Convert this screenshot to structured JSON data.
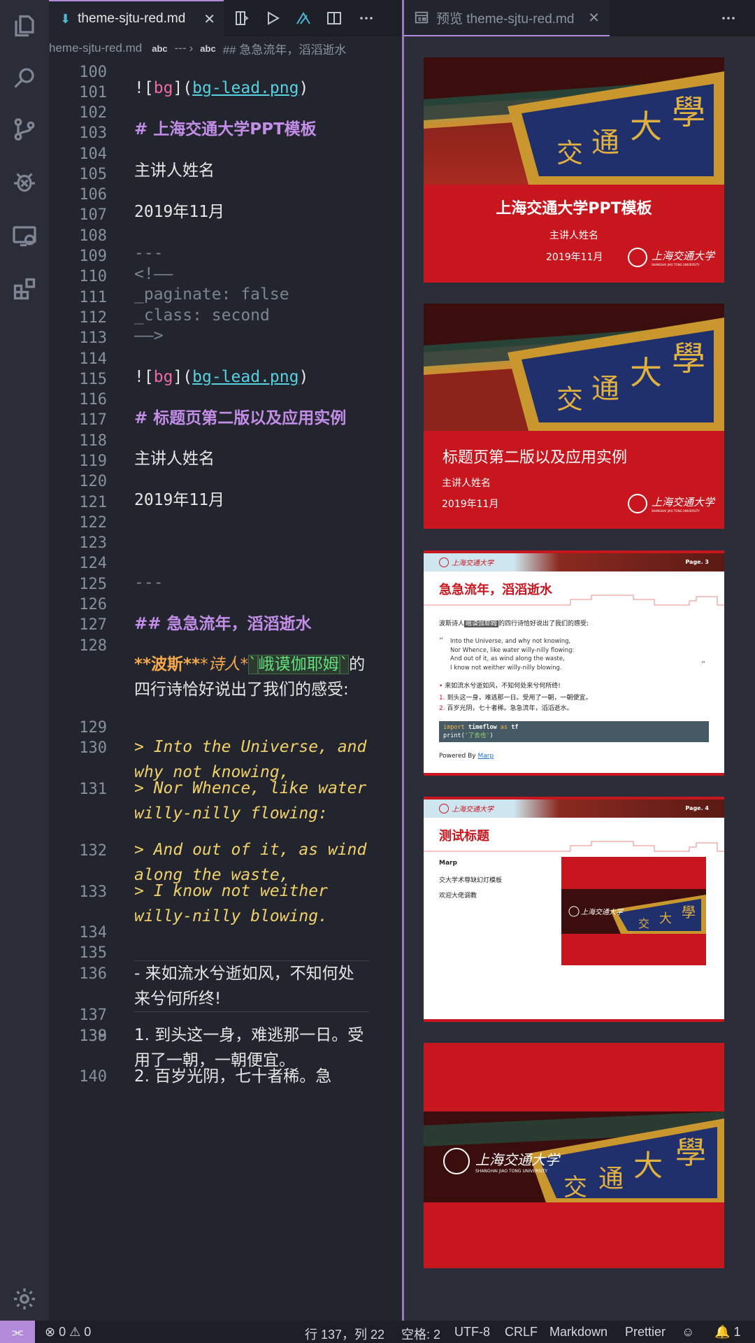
{
  "editor": {
    "tab_title": "theme-sjtu-red.md",
    "breadcrumb": {
      "file": "heme-sjtu-red.md",
      "abc1": "abc",
      "sep1": "---",
      "abc2": "abc",
      "heading": "## 急急流年，滔滔逝水"
    },
    "lines": [
      {
        "n": "100",
        "text": ""
      },
      {
        "n": "101",
        "text": "![bg](bg-lead.png)"
      },
      {
        "n": "102",
        "text": ""
      },
      {
        "n": "103",
        "text": "# 上海交通大学PPT模板"
      },
      {
        "n": "104",
        "text": ""
      },
      {
        "n": "105",
        "text": "主讲人姓名"
      },
      {
        "n": "106",
        "text": ""
      },
      {
        "n": "107",
        "text": "2019年11月"
      },
      {
        "n": "108",
        "text": ""
      },
      {
        "n": "109",
        "text": "---"
      },
      {
        "n": "110",
        "text": "<!——"
      },
      {
        "n": "111",
        "text": "_paginate: false"
      },
      {
        "n": "112",
        "text": "_class: second"
      },
      {
        "n": "113",
        "text": "——>"
      },
      {
        "n": "114",
        "text": ""
      },
      {
        "n": "115",
        "text": "![bg](bg-lead.png)"
      },
      {
        "n": "116",
        "text": ""
      },
      {
        "n": "117",
        "text": "# 标题页第二版以及应用实例"
      },
      {
        "n": "118",
        "text": ""
      },
      {
        "n": "119",
        "text": "主讲人姓名"
      },
      {
        "n": "120",
        "text": ""
      },
      {
        "n": "121",
        "text": "2019年11月"
      },
      {
        "n": "122",
        "text": ""
      },
      {
        "n": "123",
        "text": ""
      },
      {
        "n": "124",
        "text": ""
      },
      {
        "n": "125",
        "text": "---"
      },
      {
        "n": "126",
        "text": ""
      },
      {
        "n": "127",
        "text": "## 急急流年，滔滔逝水"
      },
      {
        "n": "128",
        "text": ""
      },
      {
        "n": "129",
        "text": "**波斯***诗人*`峨谟伽耶姆`的四行诗恰好说出了我们的感受:"
      },
      {
        "n": "130",
        "text": ""
      },
      {
        "n": "131",
        "text": "> Into the Universe, and why not knowing,"
      },
      {
        "n": "132",
        "text": "> Nor Whence, like water willy-nilly flowing:"
      },
      {
        "n": "133",
        "text": "> And out of it, as wind along the waste,"
      },
      {
        "n": "134",
        "text": "> I know not weither willy-nilly blowing."
      },
      {
        "n": "135",
        "text": ""
      },
      {
        "n": "136",
        "text": ""
      },
      {
        "n": "137",
        "text": "- 来如流水兮逝如风，不知何处来兮何所终!"
      },
      {
        "n": "138",
        "text": ""
      },
      {
        "n": "139",
        "text": "1. 到头这一身，难逃那一日。受用了一朝，一朝便宜。"
      },
      {
        "n": "140",
        "text": "2. 百岁光阴，七十者稀。急"
      }
    ],
    "frag": {
      "bang": "!",
      "lb": "[",
      "bg": "bg",
      "rb": "](",
      "link": "bg-lead.png",
      "rp": ")",
      "h1_103": "# 上海交通大学PPT模板",
      "h1_117": "# 标题页第二版以及应用实例",
      "h2_127": "## 急急流年，滔滔逝水",
      "b129": "**波斯**",
      "i129": "*诗人*",
      "tick": "`",
      "c129": "峨谟伽耶姆",
      "r129": "的四行诗恰好说出了我们的感受:",
      "q131": "> Into the Universe, and why not knowing,",
      "q132": "> Nor Whence, like water willy-nilly flowing:",
      "q133": "> And out of it, as wind along the waste,",
      "q134": "> I know not weither willy-nilly blowing.",
      "l137": "- 来如流水兮逝如风，不知何处来兮何所终!",
      "l139": "1. 到头这一身，难逃那一日。受用了一朝，一朝便宜。",
      "l140": "2. 百岁光阴，七十者稀。急"
    }
  },
  "preview": {
    "tab_title": "预览 theme-sjtu-red.md",
    "slides": [
      {
        "title": "上海交通大学PPT模板",
        "speaker": "主讲人姓名",
        "date": "2019年11月",
        "logo_text": "上海交通大学",
        "logo_sub": "SHANGHAI JIAO TONG UNIVERSITY"
      },
      {
        "title": "标题页第二版以及应用实例",
        "speaker": "主讲人姓名",
        "date": "2019年11月",
        "logo_text": "上海交通大学",
        "logo_sub": "SHANGHAI JIAO TONG UNIVERSITY"
      },
      {
        "page": "Page. 3",
        "logo_text": "上海交通大学",
        "title": "急急流年，滔滔逝水",
        "intro_pre": "波斯诗人",
        "intro_code": "峨谟伽耶姆",
        "intro_post": "的四行诗恰好说出了我们的感受:",
        "quote": [
          "Into the Universe, and why not knowing,",
          "Nor Whence, like water willy-nilly flowing:",
          "And out of it, as wind along the waste,",
          "I know not weither willy-nilly blowing."
        ],
        "bullet": "来如流水兮逝如风，不知何处来兮何所终!",
        "ol": [
          "到头这一身，难逃那一日。受用了一朝，一朝便宜。",
          "百岁光阴，七十者稀。急急流年，滔滔逝水。"
        ],
        "code1_kw": "import",
        "code1_mod": "timeflow",
        "code1_as": "as",
        "code1_alias": "tf",
        "code2_fn": "print(",
        "code2_str": "'了去也'",
        "code2_end": ")",
        "powered": "Powered By",
        "marp": "Marp"
      },
      {
        "page": "Page. 4",
        "logo_text": "上海交通大学",
        "title": "测试标题",
        "line1": "Marp",
        "line2": "交大学术尊缺幻灯模板",
        "line3": "欢迎大佬调教"
      },
      {
        "logo_text": "上海交通大学",
        "logo_sub": "SHANGHAI JIAO TONG UNIVERSITY"
      }
    ]
  },
  "status": {
    "errors": "0",
    "warnings": "0",
    "position": "行 137，列 22",
    "spaces": "空格: 2",
    "encoding": "UTF-8",
    "eol": "CRLF",
    "language": "Markdown",
    "formatter": "Prettier",
    "notifications": "1"
  },
  "colors": {
    "accent": "#b38ad9",
    "sjtu_red": "#c8161e"
  }
}
